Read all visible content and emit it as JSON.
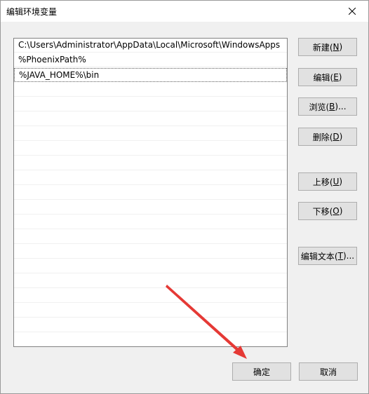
{
  "window": {
    "title": "编辑环境变量",
    "close_icon": "close-icon"
  },
  "entries": [
    "C:\\Users\\Administrator\\AppData\\Local\\Microsoft\\WindowsApps",
    "%PhoenixPath%",
    "%JAVA_HOME%\\bin",
    "",
    "",
    "",
    "",
    "",
    "",
    "",
    "",
    "",
    "",
    "",
    "",
    "",
    "",
    "",
    "",
    "",
    "",
    ""
  ],
  "selected_index": 2,
  "buttons": {
    "new": {
      "label": "新建(",
      "key": "N",
      "suffix": ")"
    },
    "edit": {
      "label": "编辑(",
      "key": "E",
      "suffix": ")"
    },
    "browse": {
      "label": "浏览(",
      "key": "B",
      "suffix": ")..."
    },
    "delete": {
      "label": "删除(",
      "key": "D",
      "suffix": ")"
    },
    "move_up": {
      "label": "上移(",
      "key": "U",
      "suffix": ")"
    },
    "move_down": {
      "label": "下移(",
      "key": "O",
      "suffix": ")"
    },
    "edit_text": {
      "label": "编辑文本(",
      "key": "T",
      "suffix": ")..."
    },
    "ok": {
      "label": "确定"
    },
    "cancel": {
      "label": "取消"
    }
  },
  "annotation": {
    "color": "#e53935"
  }
}
